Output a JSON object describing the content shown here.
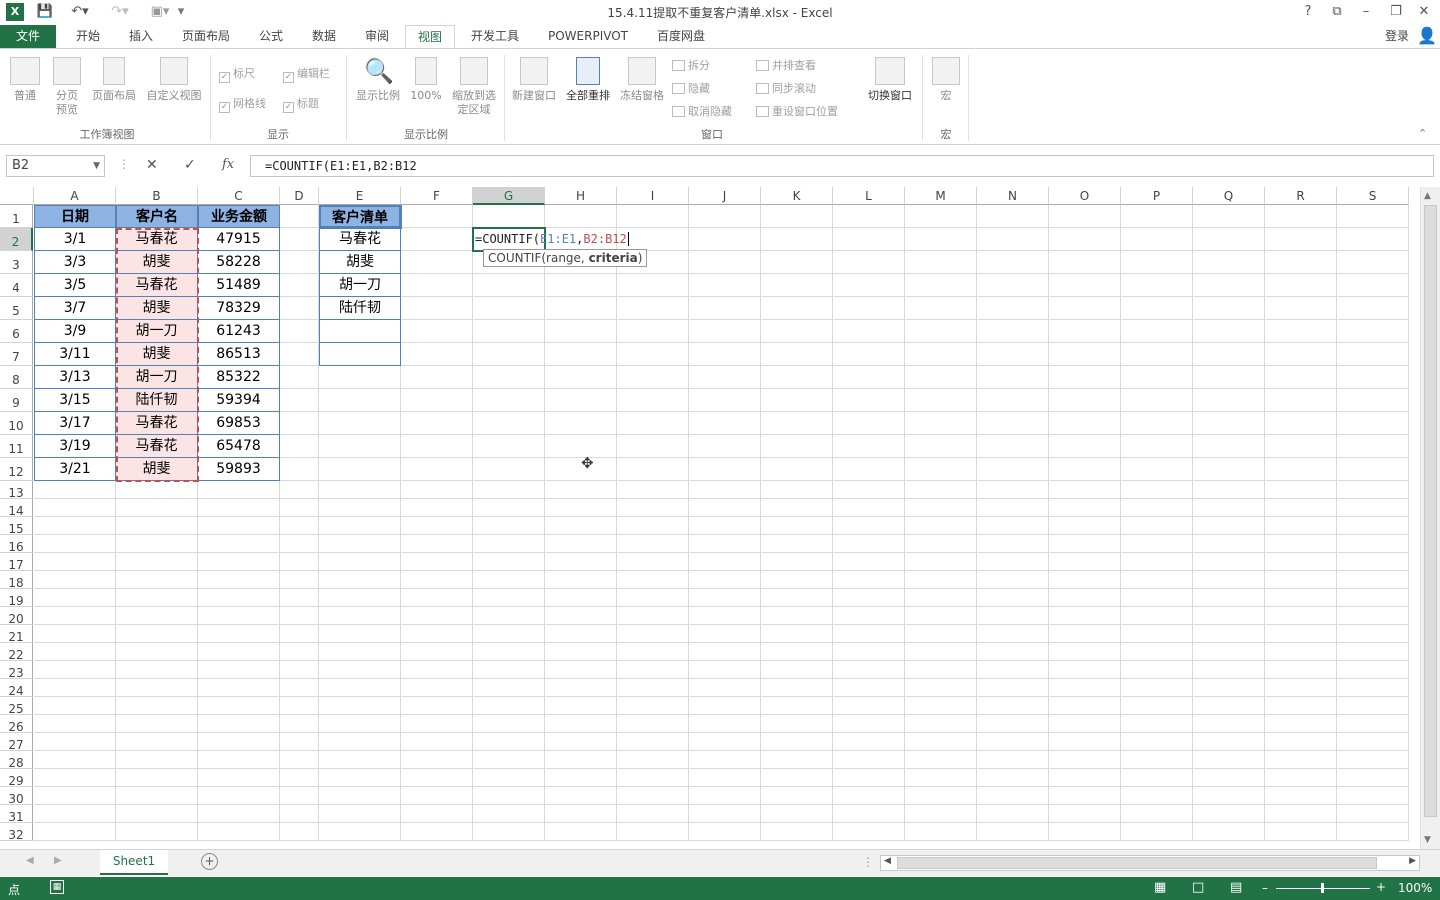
{
  "app": {
    "window_title": "15.4.11提取不重复客户清单.xlsx - Excel",
    "login": "登录"
  },
  "window_controls": [
    "?",
    "⧉",
    "–",
    "❐",
    "✕"
  ],
  "quick_access": {
    "save_icon": "save-icon",
    "undo_icon": "undo-icon",
    "redo_icon": "redo-icon",
    "camera_icon": "camera-icon"
  },
  "tabs": [
    "文件",
    "开始",
    "插入",
    "页面布局",
    "公式",
    "数据",
    "审阅",
    "视图",
    "开发工具",
    "POWERPIVOT",
    "百度网盘"
  ],
  "active_tab": "视图",
  "ribbon": {
    "workbook_views": {
      "label": "工作簿视图",
      "buttons": [
        "普通",
        "分页预览",
        "页面布局",
        "自定义视图"
      ]
    },
    "show": {
      "label": "显示",
      "checks": [
        {
          "label": "标尺",
          "checked": true
        },
        {
          "label": "编辑栏",
          "checked": true
        },
        {
          "label": "网格线",
          "checked": true
        },
        {
          "label": "标题",
          "checked": true
        }
      ]
    },
    "zoom": {
      "label": "显示比例",
      "buttons": [
        "显示比例",
        "100%",
        "缩放到选定区域"
      ]
    },
    "window": {
      "label": "窗口",
      "buttons": [
        "新建窗口",
        "全部重排",
        "冻结窗格"
      ],
      "small_left": [
        "拆分",
        "隐藏",
        "取消隐藏"
      ],
      "small_right": [
        "并排查看",
        "同步滚动",
        "重设窗口位置"
      ],
      "switch": "切换窗口"
    },
    "macro": {
      "label": "宏",
      "button": "宏"
    }
  },
  "formula_bar": {
    "name_box": "B2",
    "formula": "=COUNTIF(E1:E1,B2:B12"
  },
  "columns": [
    "A",
    "B",
    "C",
    "D",
    "E",
    "F",
    "G",
    "H",
    "I",
    "J",
    "K",
    "L",
    "M",
    "N",
    "O",
    "P",
    "Q",
    "R",
    "S"
  ],
  "rows": [
    "1",
    "2",
    "3",
    "4",
    "5",
    "6",
    "7",
    "8",
    "9",
    "10",
    "11",
    "12",
    "13",
    "14",
    "15",
    "16",
    "17",
    "18",
    "19",
    "20",
    "21",
    "22",
    "23",
    "24",
    "25",
    "26",
    "27",
    "28",
    "29",
    "30",
    "31",
    "32"
  ],
  "table": {
    "headers": [
      "日期",
      "客户名",
      "业务金额"
    ],
    "rows": [
      [
        "3/1",
        "马春花",
        "47915"
      ],
      [
        "3/3",
        "胡斐",
        "58228"
      ],
      [
        "3/5",
        "马春花",
        "51489"
      ],
      [
        "3/7",
        "胡斐",
        "78329"
      ],
      [
        "3/9",
        "胡一刀",
        "61243"
      ],
      [
        "3/11",
        "胡斐",
        "86513"
      ],
      [
        "3/13",
        "胡一刀",
        "85322"
      ],
      [
        "3/15",
        "陆仟韧",
        "59394"
      ],
      [
        "3/17",
        "马春花",
        "69853"
      ],
      [
        "3/19",
        "马春花",
        "65478"
      ],
      [
        "3/21",
        "胡斐",
        "59893"
      ]
    ]
  },
  "customer_list": {
    "header": "客户清单",
    "items": [
      "马春花",
      "胡斐",
      "胡一刀",
      "陆仟韧",
      "",
      ""
    ]
  },
  "edit_cell": {
    "prefix": "=COUNTIF(",
    "ref1": "E1:E1",
    "comma": ",",
    "ref2": "B2:B12",
    "ref1_color": "#4f81bd",
    "ref2_color": "#c0504d"
  },
  "tooltip": {
    "fn": "COUNTIF(range, ",
    "bold": "criteria",
    "close": ")"
  },
  "sheets": [
    "Sheet1"
  ],
  "status": {
    "mode": "点",
    "zoom": "100%"
  }
}
